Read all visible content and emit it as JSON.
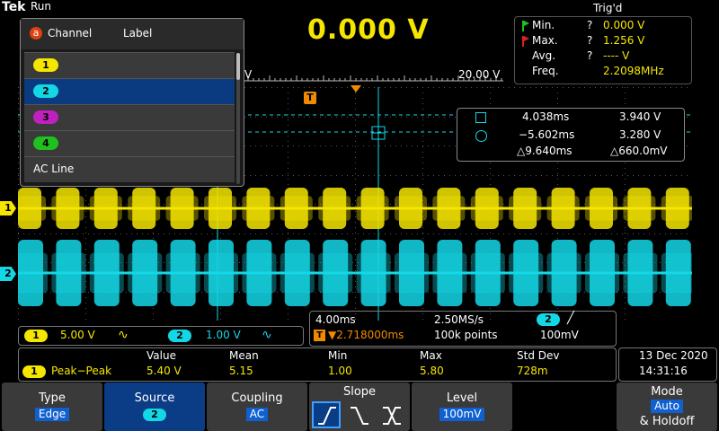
{
  "header": {
    "brand": "Tek",
    "run_status": "Run",
    "trigger_status": "Trig'd",
    "big_value": "0.000 V"
  },
  "stats": {
    "rows": [
      {
        "label": "Min.",
        "q": "?",
        "value": "0.000 V"
      },
      {
        "label": "Max.",
        "q": "?",
        "value": "1.256 V"
      },
      {
        "label": "Avg.",
        "q": "?",
        "value": "---- V"
      },
      {
        "label": "Freq.",
        "q": "",
        "value": "2.2098MHz"
      }
    ]
  },
  "ruler": {
    "left_label": "V",
    "right_label": "20.00 V"
  },
  "cursor": {
    "row1": {
      "time": "4.038ms",
      "volt": "3.940 V"
    },
    "row2": {
      "time": "−5.602ms",
      "volt": "3.280 V"
    },
    "row3": {
      "time": "△9.640ms",
      "volt": "△660.0mV"
    }
  },
  "trigger_marker": "T",
  "channel_menu": {
    "header_icon": "a",
    "header_channel": "Channel",
    "header_label": "Label",
    "items": [
      {
        "chip": "1",
        "color": "#f5e600"
      },
      {
        "chip": "2",
        "color": "#14d7e6"
      },
      {
        "chip": "3",
        "color": "#c020c0"
      },
      {
        "chip": "4",
        "color": "#20c020"
      },
      {
        "text": "AC Line"
      }
    ]
  },
  "ch_markers": {
    "ch1": "1",
    "ch2": "2"
  },
  "channel_readout": {
    "ch1": {
      "num": "1",
      "scale": "5.00 V",
      "coupling_icon": "∿"
    },
    "ch2": {
      "num": "2",
      "scale": "1.00 V",
      "coupling_icon": "∿"
    }
  },
  "horizontal": {
    "time_div": "4.00ms",
    "sample_rate": "2.50MS/s",
    "trig_source": "2",
    "slope_icon": "╱",
    "delay": "▼2.718000ms",
    "record": "100k points",
    "trig_level": "100mV"
  },
  "measurement": {
    "headers": [
      "Value",
      "Mean",
      "Min",
      "Max",
      "Std Dev"
    ],
    "chip": "1",
    "name": "Peak−Peak",
    "values": [
      "5.40 V",
      "5.15",
      "1.00",
      "5.80",
      "728m"
    ]
  },
  "datetime": {
    "date": "13 Dec  2020",
    "time": "14:31:16"
  },
  "softkeys": {
    "type": {
      "label": "Type",
      "value": "Edge"
    },
    "source": {
      "label": "Source",
      "value": "2"
    },
    "coupling": {
      "label": "Coupling",
      "value": "AC"
    },
    "slope": {
      "label": "Slope"
    },
    "level": {
      "label": "Level",
      "value": "100mV"
    },
    "mode": {
      "label": "Mode",
      "value": "Auto",
      "extra": "& Holdoff"
    }
  },
  "colors": {
    "ch1": "#f5e600",
    "ch2": "#14d7e6",
    "selection": "#0a3a80",
    "badge": "#1060d0"
  }
}
